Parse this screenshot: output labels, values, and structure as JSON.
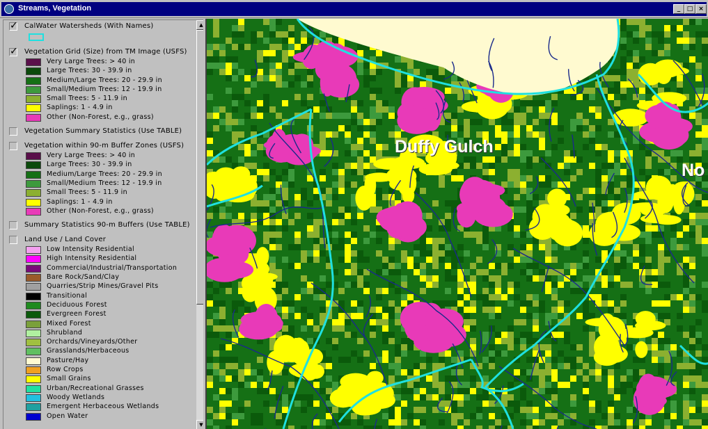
{
  "window": {
    "title": "Streams, Vegetation",
    "buttons": {
      "minimize": "_",
      "maximize": "□",
      "close": "×"
    }
  },
  "legend": {
    "layers": [
      {
        "name": "CalWater Watersheds (With Names)",
        "checked": true,
        "entries": [],
        "line_color": "#1fe0e0"
      },
      {
        "name": "Vegetation Grid (Size) from TM Image (USFS)",
        "checked": true,
        "entries": [
          {
            "label": "Very Large Trees: > 40  in",
            "color": "#5a0f4a"
          },
          {
            "label": "Large Trees: 30 - 39.9 in",
            "color": "#0b4a0b"
          },
          {
            "label": "Medium/Large Trees: 20 - 29.9 in",
            "color": "#157015"
          },
          {
            "label": "Small/Medium Trees: 12 - 19.9 in",
            "color": "#3d9a3d"
          },
          {
            "label": "Small Trees: 5 - 11.9 in",
            "color": "#8cb030"
          },
          {
            "label": "Saplings: 1 - 4.9 in",
            "color": "#ffff00"
          },
          {
            "label": "Other (Non-Forest, e.g., grass)",
            "color": "#e83ab8"
          }
        ]
      },
      {
        "name": "Vegetation Summary Statistics (Use TABLE)",
        "checked": false,
        "entries": []
      },
      {
        "name": "Vegetation within 90-m Buffer Zones (USFS)",
        "checked": false,
        "entries": [
          {
            "label": "Very Large Trees: > 40  in",
            "color": "#5a0f4a"
          },
          {
            "label": "Large Trees: 30 - 39.9 in",
            "color": "#0b4a0b"
          },
          {
            "label": "Medium/Large Trees: 20 - 29.9 in",
            "color": "#157015"
          },
          {
            "label": "Small/Medium Trees: 12 - 19.9 in",
            "color": "#3d9a3d"
          },
          {
            "label": "Small Trees: 5 - 11.9 in",
            "color": "#8cb030"
          },
          {
            "label": "Saplings: 1 - 4.9 in",
            "color": "#ffff00"
          },
          {
            "label": "Other (Non-Forest, e.g., grass)",
            "color": "#e83ab8"
          }
        ]
      },
      {
        "name": "Summary Statistics 90-m Buffers (Use TABLE)",
        "checked": false,
        "entries": []
      },
      {
        "name": "Land Use / Land Cover",
        "checked": false,
        "entries": [
          {
            "label": "Low Intensity Residential",
            "color": "#f4a0f0"
          },
          {
            "label": "High Intensity Residential",
            "color": "#ff00ff"
          },
          {
            "label": "Commercial/Industrial/Transportation",
            "color": "#7a0a7a"
          },
          {
            "label": "Bare Rock/Sand/Clay",
            "color": "#9a5a2a"
          },
          {
            "label": "Quarries/Strip Mines/Gravel Pits",
            "color": "#a0a0a0"
          },
          {
            "label": "Transitional",
            "color": "#000000"
          },
          {
            "label": "Deciduous Forest",
            "color": "#1e8a1e"
          },
          {
            "label": "Evergreen Forest",
            "color": "#0b5a0b"
          },
          {
            "label": "Mixed Forest",
            "color": "#7aa03a"
          },
          {
            "label": "Shrubland",
            "color": "#b0f0a0"
          },
          {
            "label": "Orchards/Vineyards/Other",
            "color": "#a0c040"
          },
          {
            "label": "Grasslands/Herbaceous",
            "color": "#60c060"
          },
          {
            "label": "Pasture/Hay",
            "color": "#fffad0"
          },
          {
            "label": "Row Crops",
            "color": "#f0a020"
          },
          {
            "label": "Small Grains",
            "color": "#ffff00"
          },
          {
            "label": "Urban/Recreational Grasses",
            "color": "#20e0a0"
          },
          {
            "label": "Woody Wetlands",
            "color": "#20c0e0"
          },
          {
            "label": "Emergent Herbaceous Wetlands",
            "color": "#20a0a0"
          },
          {
            "label": "Open Water",
            "color": "#0000d0"
          }
        ]
      }
    ]
  },
  "map": {
    "labels": [
      {
        "text": "Duffy Gulch"
      },
      {
        "text": "No"
      }
    ],
    "colors": {
      "forest_dark": "#0b5a0b",
      "forest_mid": "#157015",
      "forest_light": "#3d9a3d",
      "small_trees": "#8cb030",
      "saplings": "#ffff00",
      "other": "#e83ab8",
      "pasture": "#fffad0",
      "watershed": "#1fe0e0",
      "stream": "#1a2a8a"
    }
  }
}
